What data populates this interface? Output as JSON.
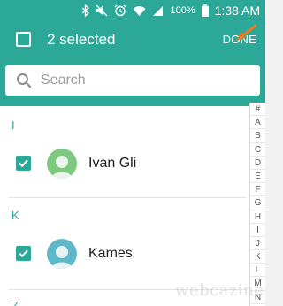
{
  "status_bar": {
    "battery_percent": "100%",
    "time": "1:38 AM",
    "icons": [
      "bluetooth-icon",
      "mute-icon",
      "alarm-icon",
      "wifi-icon",
      "signal-icon",
      "battery-icon"
    ]
  },
  "action_bar": {
    "selected_label": "2 selected",
    "done_label": "DONE"
  },
  "search": {
    "placeholder": "Search"
  },
  "contacts": [
    {
      "section": "I",
      "name": "Ivan Gli",
      "checked": true,
      "avatar_color": "#7dc97f"
    },
    {
      "section": "K",
      "name": "Kames",
      "checked": true,
      "avatar_color": "#5fb8c9"
    }
  ],
  "next_section": "Z",
  "index_letters": [
    "#",
    "A",
    "B",
    "C",
    "D",
    "E",
    "F",
    "G",
    "H",
    "I",
    "J",
    "K",
    "L",
    "M",
    "N"
  ],
  "watermark": "webcazine",
  "colors": {
    "accent": "#2ba897",
    "arrow": "#e87a2a"
  }
}
